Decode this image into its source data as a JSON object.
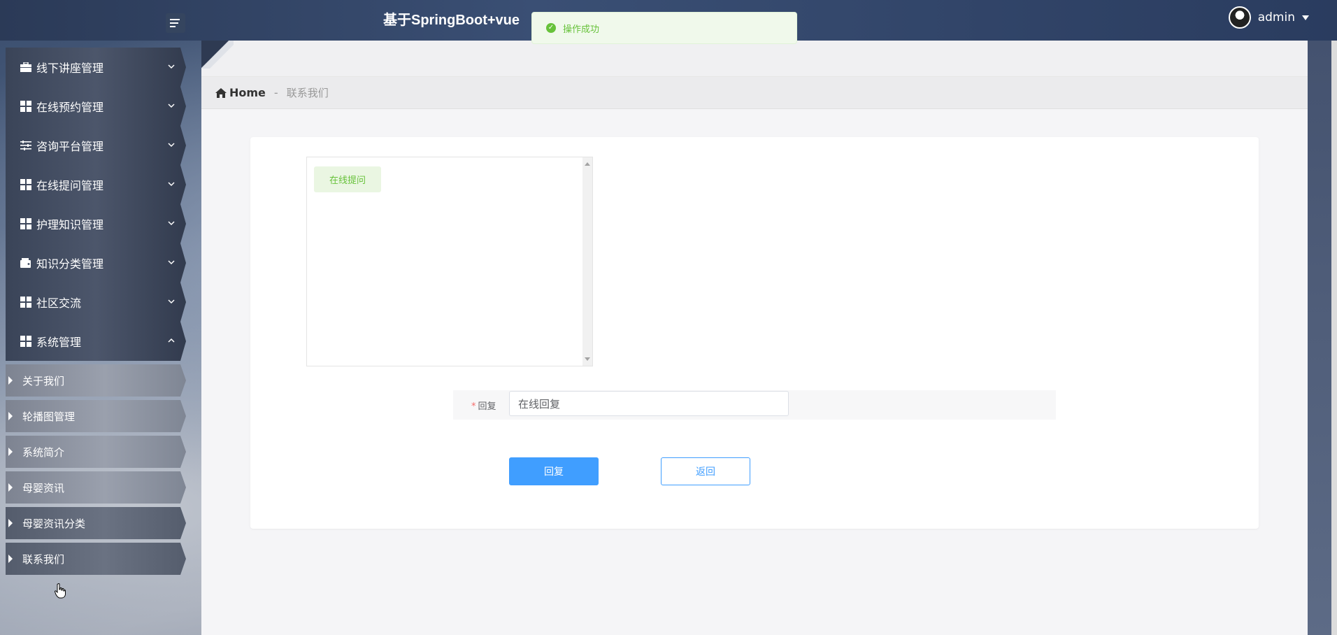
{
  "header": {
    "title": "基于SpringBoot+vue",
    "username": "admin"
  },
  "toast": {
    "message": "操作成功"
  },
  "sidebar": {
    "items": [
      {
        "label": "线下讲座管理",
        "icon": "briefcase-icon"
      },
      {
        "label": "在线预约管理",
        "icon": "grid-icon"
      },
      {
        "label": "咨询平台管理",
        "icon": "sliders-icon"
      },
      {
        "label": "在线提问管理",
        "icon": "grid-icon"
      },
      {
        "label": "护理知识管理",
        "icon": "grid-icon"
      },
      {
        "label": "知识分类管理",
        "icon": "wallet-icon"
      },
      {
        "label": "社区交流",
        "icon": "grid-icon"
      },
      {
        "label": "系统管理",
        "icon": "grid-icon"
      }
    ],
    "sub_items": [
      {
        "label": "关于我们"
      },
      {
        "label": "轮播图管理"
      },
      {
        "label": "系统简介"
      },
      {
        "label": "母婴资讯"
      },
      {
        "label": "母婴资讯分类"
      },
      {
        "label": "联系我们"
      }
    ]
  },
  "breadcrumb": {
    "home": "Home",
    "separator": "-",
    "current": "联系我们"
  },
  "chat": {
    "messages": [
      "在线提问"
    ]
  },
  "form": {
    "reply_label": "回复",
    "reply_value": "在线回复"
  },
  "buttons": {
    "submit": "回复",
    "back": "返回"
  },
  "colors": {
    "primary": "#409eff",
    "success": "#67c23a",
    "required": "#f56c6c"
  }
}
